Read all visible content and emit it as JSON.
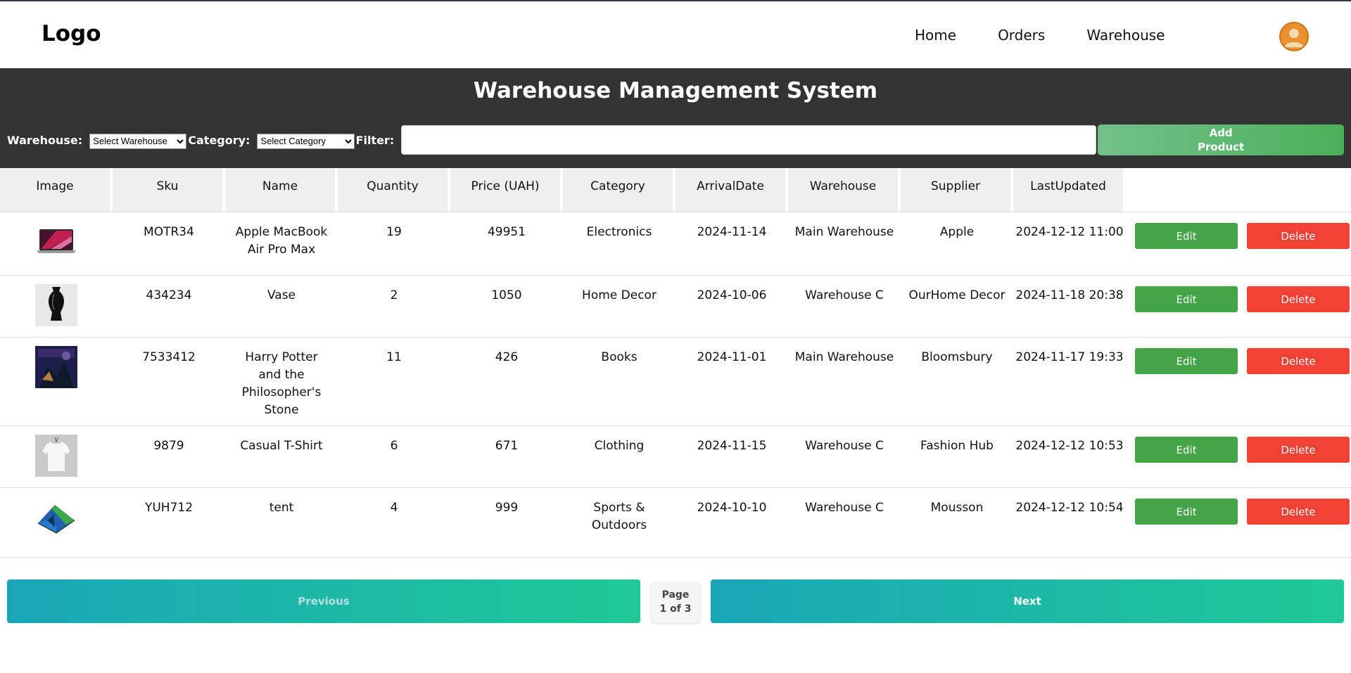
{
  "header": {
    "logo": "Logo",
    "nav": [
      "Home",
      "Orders",
      "Warehouse"
    ]
  },
  "banner": {
    "title": "Warehouse Management System",
    "warehouse_label": "Warehouse:",
    "warehouse_selected": "Select Warehouse",
    "category_label": "Category:",
    "category_selected": "Select Category",
    "filter_label": "Filter:",
    "filter_value": "",
    "add_button_line1": "Add",
    "add_button_line2": "Product"
  },
  "table": {
    "columns": [
      "Image",
      "Sku",
      "Name",
      "Quantity",
      "Price (UAH)",
      "Category",
      "ArrivalDate",
      "Warehouse",
      "Supplier",
      "LastUpdated"
    ],
    "edit_label": "Edit",
    "delete_label": "Delete",
    "rows": [
      {
        "image": "laptop-image",
        "sku": "MOTR34",
        "name": "Apple MacBook Air Pro Max",
        "quantity": "19",
        "price": "49951",
        "category": "Electronics",
        "arrival": "2024-11-14",
        "warehouse": "Main Warehouse",
        "supplier": "Apple",
        "updated": "2024-12-12 11:00"
      },
      {
        "image": "vase-image",
        "sku": "434234",
        "name": "Vase",
        "quantity": "2",
        "price": "1050",
        "category": "Home Decor",
        "arrival": "2024-10-06",
        "warehouse": "Warehouse C",
        "supplier": "OurHome Decor",
        "updated": "2024-11-18 20:38"
      },
      {
        "image": "book-image",
        "sku": "7533412",
        "name": "Harry Potter and the Philosopher's Stone",
        "quantity": "11",
        "price": "426",
        "category": "Books",
        "arrival": "2024-11-01",
        "warehouse": "Main Warehouse",
        "supplier": "Bloomsbury",
        "updated": "2024-11-17 19:33"
      },
      {
        "image": "tshirt-image",
        "sku": "9879",
        "name": "Casual T-Shirt",
        "quantity": "6",
        "price": "671",
        "category": "Clothing",
        "arrival": "2024-11-15",
        "warehouse": "Warehouse C",
        "supplier": "Fashion Hub",
        "updated": "2024-12-12 10:53"
      },
      {
        "image": "tent-image",
        "sku": "YUH712",
        "name": "tent",
        "quantity": "4",
        "price": "999",
        "category": "Sports & Outdoors",
        "arrival": "2024-10-10",
        "warehouse": "Warehouse C",
        "supplier": "Mousson",
        "updated": "2024-12-12 10:54"
      }
    ]
  },
  "pagination": {
    "previous": "Previous",
    "next": "Next",
    "page_line1": "Page",
    "page_line2": "1 of 3"
  },
  "colors": {
    "banner": "#333333",
    "edit": "#43a547",
    "delete": "#f24236",
    "avatar": "#e8912d",
    "pager_gradient_start": "#1aa6b7",
    "pager_gradient_end": "#1fc996"
  }
}
